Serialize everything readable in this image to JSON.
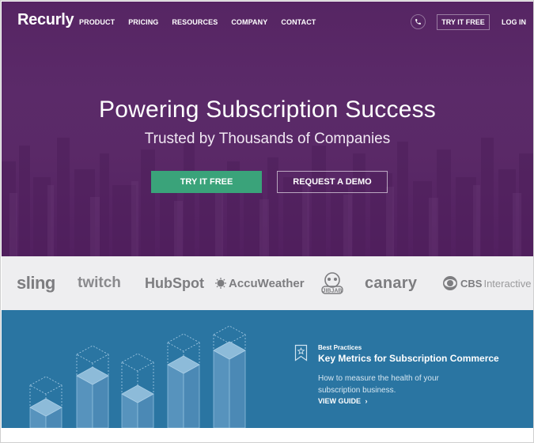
{
  "header": {
    "logo": "Recurly",
    "nav": [
      "PRODUCT",
      "PRICING",
      "RESOURCES",
      "COMPANY",
      "CONTACT"
    ],
    "phone_icon": "phone-icon",
    "try_free": "TRY IT FREE",
    "login": "LOG IN"
  },
  "hero": {
    "title": "Powering Subscription Success",
    "subtitle": "Trusted by Thousands of Companies",
    "primary_cta": "TRY IT FREE",
    "secondary_cta": "REQUEST A DEMO"
  },
  "customers": {
    "logos": [
      {
        "name": "sling",
        "text": "sling"
      },
      {
        "name": "twitch",
        "text": "twitch"
      },
      {
        "name": "hubspot",
        "text": "HubSpot"
      },
      {
        "name": "accuweather",
        "text": "AccuWeather"
      },
      {
        "name": "jibjab",
        "text": "JibJab"
      },
      {
        "name": "canary",
        "text": "canary"
      },
      {
        "name": "cbs-interactive",
        "text_bold": "CBS",
        "text_light": "Interactive"
      }
    ]
  },
  "promo": {
    "eyebrow": "Best Practices",
    "title": "Key Metrics for Subscription Commerce",
    "description": "How to measure the health of your subscription business.",
    "link": "VIEW GUIDE",
    "link_icon": "›"
  },
  "colors": {
    "hero_purple": "#5a2967",
    "cta_green": "#3aa37a",
    "logo_strip": "#eeeef0",
    "promo_blue": "#2a75a2"
  }
}
